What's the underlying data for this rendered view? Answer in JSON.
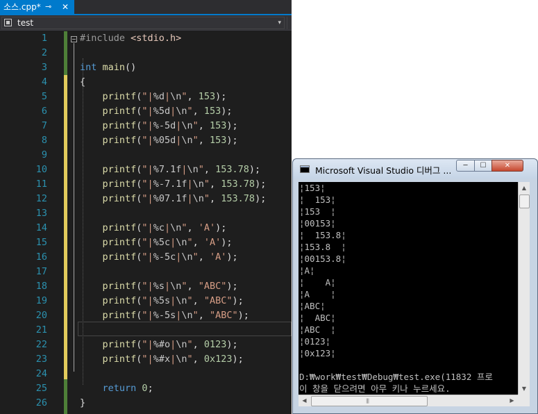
{
  "editor": {
    "tab": {
      "title": "소스.cpp*",
      "pin_glyph": "⊸",
      "close_glyph": "✕"
    },
    "nav": {
      "project": "test",
      "dropdown_glyph": "▾"
    },
    "lines": [
      {
        "num": "1",
        "tokens": [
          {
            "c": "pre",
            "t": "#include "
          },
          {
            "c": "inc",
            "t": "<stdio.h>"
          }
        ]
      },
      {
        "num": "2",
        "tokens": []
      },
      {
        "num": "3",
        "tokens": [
          {
            "c": "kw",
            "t": "int"
          },
          {
            "c": "pun",
            "t": " "
          },
          {
            "c": "fn",
            "t": "main"
          },
          {
            "c": "pun",
            "t": "()"
          }
        ]
      },
      {
        "num": "4",
        "tokens": [
          {
            "c": "pun",
            "t": "{"
          }
        ]
      },
      {
        "num": "5",
        "tokens": [
          {
            "c": "fn",
            "t": "    printf"
          },
          {
            "c": "pun",
            "t": "("
          },
          {
            "c": "str",
            "t": "\"|"
          },
          {
            "c": "fmt",
            "t": "%d"
          },
          {
            "c": "str",
            "t": "|"
          },
          {
            "c": "esc",
            "t": "\\n"
          },
          {
            "c": "str",
            "t": "\""
          },
          {
            "c": "pun",
            "t": ", "
          },
          {
            "c": "num",
            "t": "153"
          },
          {
            "c": "pun",
            "t": ");"
          }
        ]
      },
      {
        "num": "6",
        "tokens": [
          {
            "c": "fn",
            "t": "    printf"
          },
          {
            "c": "pun",
            "t": "("
          },
          {
            "c": "str",
            "t": "\"|"
          },
          {
            "c": "fmt",
            "t": "%5d"
          },
          {
            "c": "str",
            "t": "|"
          },
          {
            "c": "esc",
            "t": "\\n"
          },
          {
            "c": "str",
            "t": "\""
          },
          {
            "c": "pun",
            "t": ", "
          },
          {
            "c": "num",
            "t": "153"
          },
          {
            "c": "pun",
            "t": ");"
          }
        ]
      },
      {
        "num": "7",
        "tokens": [
          {
            "c": "fn",
            "t": "    printf"
          },
          {
            "c": "pun",
            "t": "("
          },
          {
            "c": "str",
            "t": "\"|"
          },
          {
            "c": "fmt",
            "t": "%-5d"
          },
          {
            "c": "str",
            "t": "|"
          },
          {
            "c": "esc",
            "t": "\\n"
          },
          {
            "c": "str",
            "t": "\""
          },
          {
            "c": "pun",
            "t": ", "
          },
          {
            "c": "num",
            "t": "153"
          },
          {
            "c": "pun",
            "t": ");"
          }
        ]
      },
      {
        "num": "8",
        "tokens": [
          {
            "c": "fn",
            "t": "    printf"
          },
          {
            "c": "pun",
            "t": "("
          },
          {
            "c": "str",
            "t": "\"|"
          },
          {
            "c": "fmt",
            "t": "%05d"
          },
          {
            "c": "str",
            "t": "|"
          },
          {
            "c": "esc",
            "t": "\\n"
          },
          {
            "c": "str",
            "t": "\""
          },
          {
            "c": "pun",
            "t": ", "
          },
          {
            "c": "num",
            "t": "153"
          },
          {
            "c": "pun",
            "t": ");"
          }
        ]
      },
      {
        "num": "9",
        "tokens": []
      },
      {
        "num": "10",
        "tokens": [
          {
            "c": "fn",
            "t": "    printf"
          },
          {
            "c": "pun",
            "t": "("
          },
          {
            "c": "str",
            "t": "\"|"
          },
          {
            "c": "fmt",
            "t": "%7.1f"
          },
          {
            "c": "str",
            "t": "|"
          },
          {
            "c": "esc",
            "t": "\\n"
          },
          {
            "c": "str",
            "t": "\""
          },
          {
            "c": "pun",
            "t": ", "
          },
          {
            "c": "num",
            "t": "153.78"
          },
          {
            "c": "pun",
            "t": ");"
          }
        ]
      },
      {
        "num": "11",
        "tokens": [
          {
            "c": "fn",
            "t": "    printf"
          },
          {
            "c": "pun",
            "t": "("
          },
          {
            "c": "str",
            "t": "\"|"
          },
          {
            "c": "fmt",
            "t": "%-7.1f"
          },
          {
            "c": "str",
            "t": "|"
          },
          {
            "c": "esc",
            "t": "\\n"
          },
          {
            "c": "str",
            "t": "\""
          },
          {
            "c": "pun",
            "t": ", "
          },
          {
            "c": "num",
            "t": "153.78"
          },
          {
            "c": "pun",
            "t": ");"
          }
        ]
      },
      {
        "num": "12",
        "tokens": [
          {
            "c": "fn",
            "t": "    printf"
          },
          {
            "c": "pun",
            "t": "("
          },
          {
            "c": "str",
            "t": "\"|"
          },
          {
            "c": "fmt",
            "t": "%07.1f"
          },
          {
            "c": "str",
            "t": "|"
          },
          {
            "c": "esc",
            "t": "\\n"
          },
          {
            "c": "str",
            "t": "\""
          },
          {
            "c": "pun",
            "t": ", "
          },
          {
            "c": "num",
            "t": "153.78"
          },
          {
            "c": "pun",
            "t": ");"
          }
        ]
      },
      {
        "num": "13",
        "tokens": []
      },
      {
        "num": "14",
        "tokens": [
          {
            "c": "fn",
            "t": "    printf"
          },
          {
            "c": "pun",
            "t": "("
          },
          {
            "c": "str",
            "t": "\"|"
          },
          {
            "c": "fmt",
            "t": "%c"
          },
          {
            "c": "str",
            "t": "|"
          },
          {
            "c": "esc",
            "t": "\\n"
          },
          {
            "c": "str",
            "t": "\""
          },
          {
            "c": "pun",
            "t": ", "
          },
          {
            "c": "str",
            "t": "'A'"
          },
          {
            "c": "pun",
            "t": ");"
          }
        ]
      },
      {
        "num": "15",
        "tokens": [
          {
            "c": "fn",
            "t": "    printf"
          },
          {
            "c": "pun",
            "t": "("
          },
          {
            "c": "str",
            "t": "\"|"
          },
          {
            "c": "fmt",
            "t": "%5c"
          },
          {
            "c": "str",
            "t": "|"
          },
          {
            "c": "esc",
            "t": "\\n"
          },
          {
            "c": "str",
            "t": "\""
          },
          {
            "c": "pun",
            "t": ", "
          },
          {
            "c": "str",
            "t": "'A'"
          },
          {
            "c": "pun",
            "t": ");"
          }
        ]
      },
      {
        "num": "16",
        "tokens": [
          {
            "c": "fn",
            "t": "    printf"
          },
          {
            "c": "pun",
            "t": "("
          },
          {
            "c": "str",
            "t": "\"|"
          },
          {
            "c": "fmt",
            "t": "%-5c"
          },
          {
            "c": "str",
            "t": "|"
          },
          {
            "c": "esc",
            "t": "\\n"
          },
          {
            "c": "str",
            "t": "\""
          },
          {
            "c": "pun",
            "t": ", "
          },
          {
            "c": "str",
            "t": "'A'"
          },
          {
            "c": "pun",
            "t": ");"
          }
        ]
      },
      {
        "num": "17",
        "tokens": []
      },
      {
        "num": "18",
        "tokens": [
          {
            "c": "fn",
            "t": "    printf"
          },
          {
            "c": "pun",
            "t": "("
          },
          {
            "c": "str",
            "t": "\"|"
          },
          {
            "c": "fmt",
            "t": "%s"
          },
          {
            "c": "str",
            "t": "|"
          },
          {
            "c": "esc",
            "t": "\\n"
          },
          {
            "c": "str",
            "t": "\""
          },
          {
            "c": "pun",
            "t": ", "
          },
          {
            "c": "str",
            "t": "\"ABC\""
          },
          {
            "c": "pun",
            "t": ");"
          }
        ]
      },
      {
        "num": "19",
        "tokens": [
          {
            "c": "fn",
            "t": "    printf"
          },
          {
            "c": "pun",
            "t": "("
          },
          {
            "c": "str",
            "t": "\"|"
          },
          {
            "c": "fmt",
            "t": "%5s"
          },
          {
            "c": "str",
            "t": "|"
          },
          {
            "c": "esc",
            "t": "\\n"
          },
          {
            "c": "str",
            "t": "\""
          },
          {
            "c": "pun",
            "t": ", "
          },
          {
            "c": "str",
            "t": "\"ABC\""
          },
          {
            "c": "pun",
            "t": ");"
          }
        ]
      },
      {
        "num": "20",
        "tokens": [
          {
            "c": "fn",
            "t": "    printf"
          },
          {
            "c": "pun",
            "t": "("
          },
          {
            "c": "str",
            "t": "\"|"
          },
          {
            "c": "fmt",
            "t": "%-5s"
          },
          {
            "c": "str",
            "t": "|"
          },
          {
            "c": "esc",
            "t": "\\n"
          },
          {
            "c": "str",
            "t": "\""
          },
          {
            "c": "pun",
            "t": ", "
          },
          {
            "c": "str",
            "t": "\"ABC\""
          },
          {
            "c": "pun",
            "t": ");"
          }
        ]
      },
      {
        "num": "21",
        "tokens": []
      },
      {
        "num": "22",
        "tokens": [
          {
            "c": "fn",
            "t": "    printf"
          },
          {
            "c": "pun",
            "t": "("
          },
          {
            "c": "str",
            "t": "\"|"
          },
          {
            "c": "fmt",
            "t": "%#o"
          },
          {
            "c": "str",
            "t": "|"
          },
          {
            "c": "esc",
            "t": "\\n"
          },
          {
            "c": "str",
            "t": "\""
          },
          {
            "c": "pun",
            "t": ", "
          },
          {
            "c": "num",
            "t": "0123"
          },
          {
            "c": "pun",
            "t": ");"
          }
        ]
      },
      {
        "num": "23",
        "tokens": [
          {
            "c": "fn",
            "t": "    printf"
          },
          {
            "c": "pun",
            "t": "("
          },
          {
            "c": "str",
            "t": "\"|"
          },
          {
            "c": "fmt",
            "t": "%#x"
          },
          {
            "c": "str",
            "t": "|"
          },
          {
            "c": "esc",
            "t": "\\n"
          },
          {
            "c": "str",
            "t": "\""
          },
          {
            "c": "pun",
            "t": ", "
          },
          {
            "c": "num",
            "t": "0x123"
          },
          {
            "c": "pun",
            "t": ");"
          }
        ]
      },
      {
        "num": "24",
        "tokens": []
      },
      {
        "num": "25",
        "tokens": [
          {
            "c": "kw",
            "t": "    return"
          },
          {
            "c": "pun",
            "t": " "
          },
          {
            "c": "num",
            "t": "0"
          },
          {
            "c": "pun",
            "t": ";"
          }
        ]
      },
      {
        "num": "26",
        "tokens": [
          {
            "c": "pun",
            "t": "}"
          }
        ]
      }
    ]
  },
  "console": {
    "title": "Microsoft Visual Studio 디버그 ...",
    "buttons": {
      "minimize": "─",
      "maximize": "☐",
      "close": "✕"
    },
    "scroll": {
      "up": "▲",
      "down": "▼",
      "left": "◀",
      "right": "▶",
      "grip": "|||"
    },
    "output": [
      "¦153¦",
      "¦  153¦",
      "¦153  ¦",
      "¦00153¦",
      "¦  153.8¦",
      "¦153.8  ¦",
      "¦00153.8¦",
      "¦A¦",
      "¦    A¦",
      "¦A    ¦",
      "¦ABC¦",
      "¦  ABC¦",
      "¦ABC  ¦",
      "¦0123¦",
      "¦0x123¦",
      "",
      "D:₩work₩test₩Debug₩test.exe(11832 프로",
      "이 창을 닫으려면 아무 키나 누르세요."
    ]
  }
}
